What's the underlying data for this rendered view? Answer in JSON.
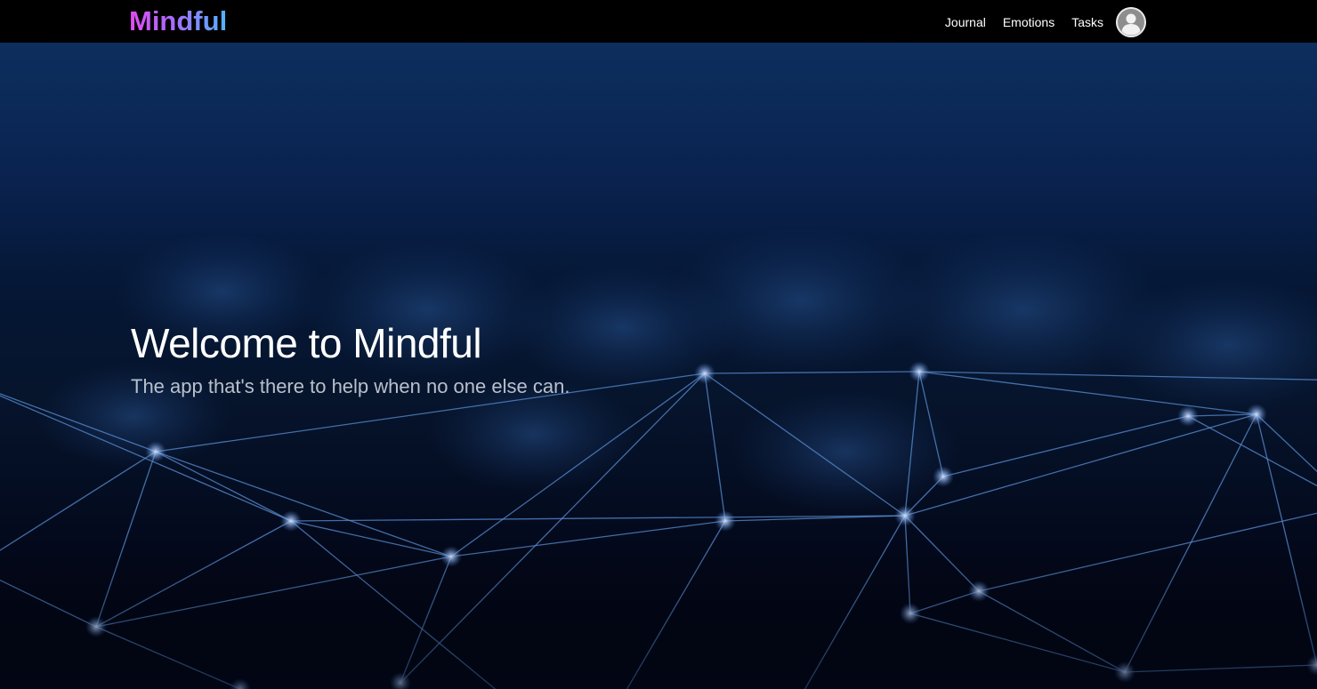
{
  "nav": {
    "brand": "Mindful",
    "links": [
      "Journal",
      "Emotions",
      "Tasks"
    ],
    "avatar_icon": "user-avatar-icon"
  },
  "hero": {
    "title": "Welcome to Mindful",
    "subtitle": "The app that's there to help when no one else can."
  },
  "colors": {
    "nav_bg": "#000000",
    "brand_gradient_start": "#e14bf0",
    "brand_gradient_end": "#4fb4ff",
    "hero_bg_top": "#0d2f5e",
    "hero_bg_bottom": "#020614",
    "network_line": "#5a8fd6"
  }
}
